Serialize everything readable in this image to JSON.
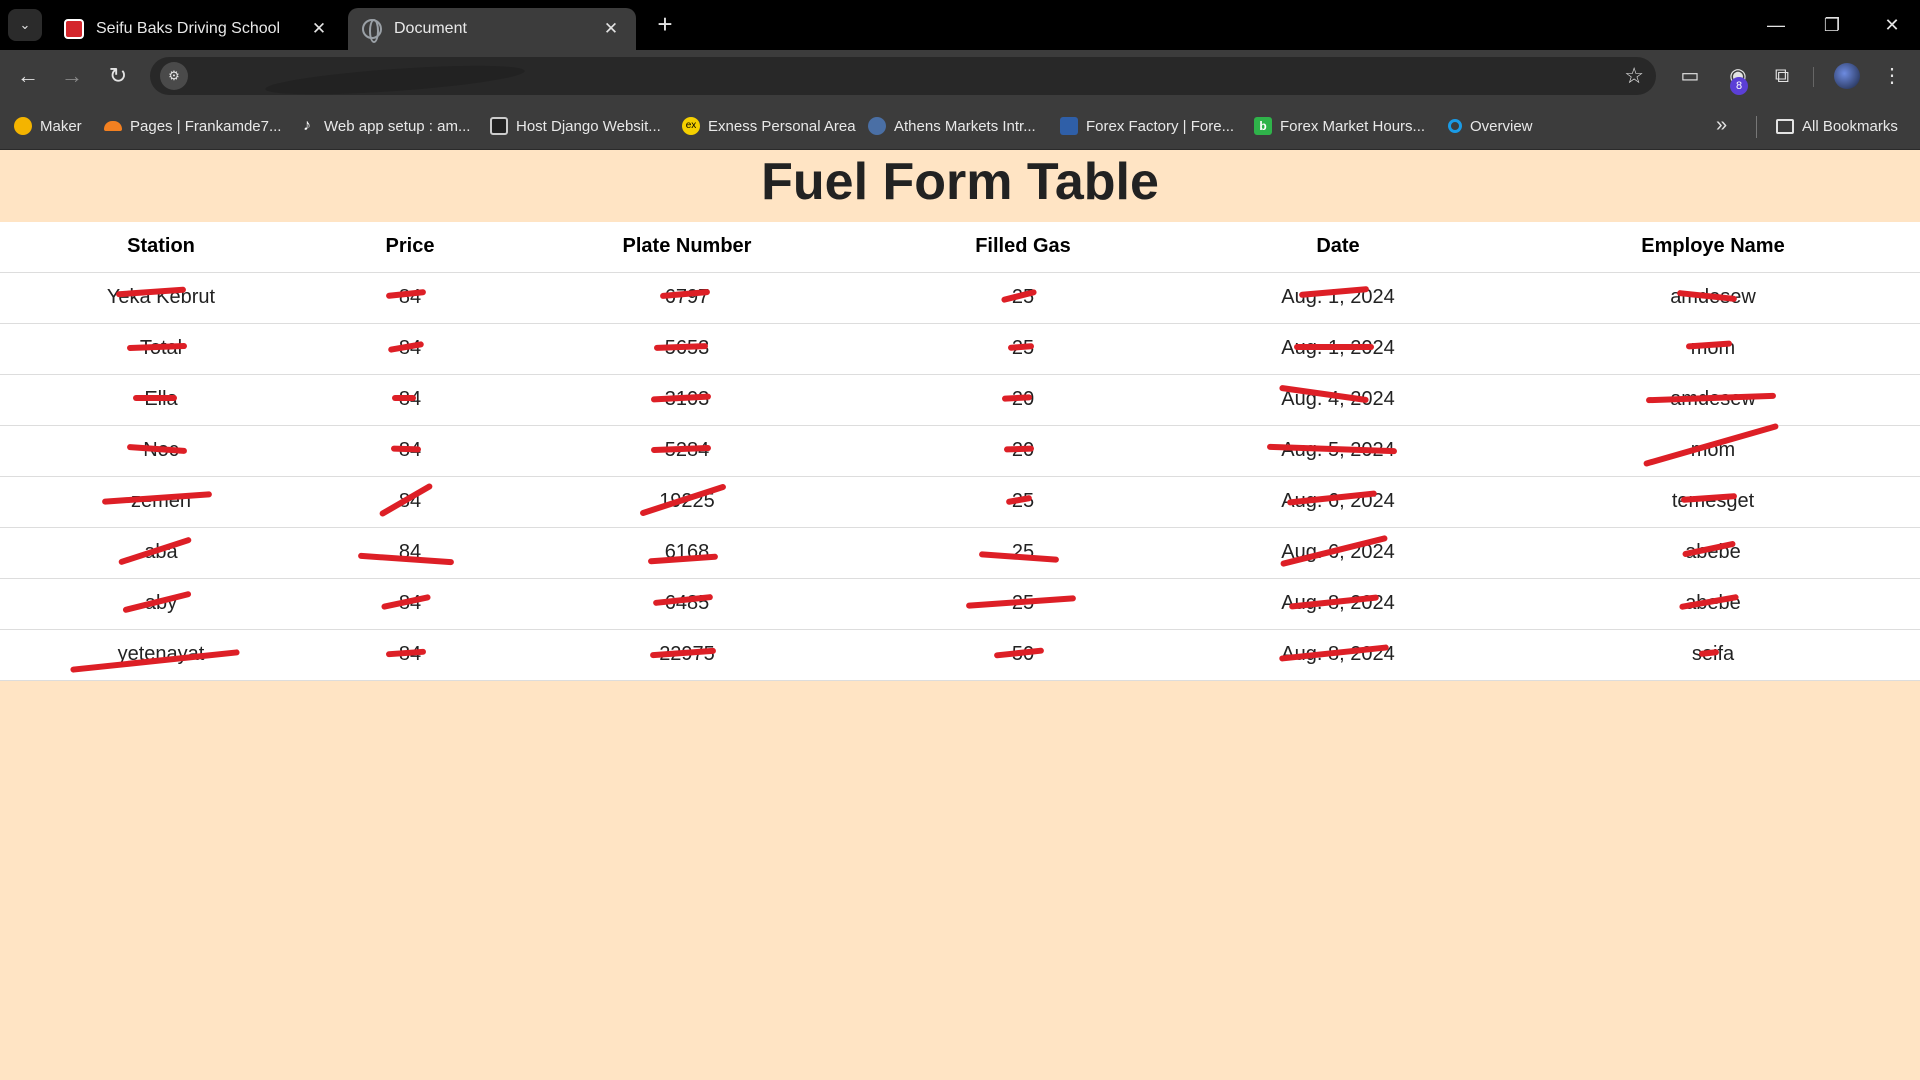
{
  "browser": {
    "tabs": [
      {
        "title": "Seifu Baks Driving School",
        "active": false,
        "icon": "seifu-favicon"
      },
      {
        "title": "Document",
        "active": true,
        "icon": "globe-icon"
      }
    ],
    "new_tab_label": "+",
    "bookmarks": [
      {
        "label": "Maker",
        "icon": "maker-icon",
        "color": "#f4b400"
      },
      {
        "label": "Pages | Frankamde7...",
        "icon": "cloudflare-icon",
        "color": "#f38020"
      },
      {
        "label": "Web app setup : am...",
        "icon": "tiktok-icon",
        "color": "#ffffff"
      },
      {
        "label": "Host Django Websit...",
        "icon": "page-icon",
        "color": "#cccccc"
      },
      {
        "label": "Exness Personal Area",
        "icon": "exness-icon",
        "color": "#f5d000"
      },
      {
        "label": "Athens Markets Intr...",
        "icon": "globe-icon",
        "color": "#4a6fa5"
      },
      {
        "label": "Forex Factory | Fore...",
        "icon": "forexfactory-icon",
        "color": "#2f5fa8"
      },
      {
        "label": "Forex Market Hours...",
        "icon": "b-icon",
        "color": "#2fb34a"
      },
      {
        "label": "Overview",
        "icon": "overview-icon",
        "color": "#1a9be6"
      }
    ],
    "all_bookmarks_label": "All Bookmarks",
    "extension_badge": "8"
  },
  "page": {
    "title": "Fuel Form Table",
    "table": {
      "headers": [
        "Station",
        "Price",
        "Plate Number",
        "Filled Gas",
        "Date",
        "Employe Name"
      ],
      "rows": [
        [
          "Yeka Kebrut",
          "84",
          "6797",
          "25",
          "Aug. 1, 2024",
          "amdesew"
        ],
        [
          "Total",
          "84",
          "5653",
          "25",
          "Aug. 1, 2024",
          "mom"
        ],
        [
          "Ella",
          "84",
          "3103",
          "20",
          "Aug. 4, 2024",
          "amdesew"
        ],
        [
          "Noc",
          "84",
          "5284",
          "20",
          "Aug. 5, 2024",
          "mom"
        ],
        [
          "zemen",
          "84",
          "19225",
          "25",
          "Aug. 6, 2024",
          "temesget"
        ],
        [
          "aba",
          "84",
          "6168",
          "25",
          "Aug. 6, 2024",
          "abebe"
        ],
        [
          "aby",
          "84",
          "6485",
          "25",
          "Aug. 8, 2024",
          "abebe"
        ],
        [
          "yetenayat",
          "84",
          "22975",
          "50",
          "Aug. 8, 2024",
          "seifa"
        ]
      ]
    }
  }
}
